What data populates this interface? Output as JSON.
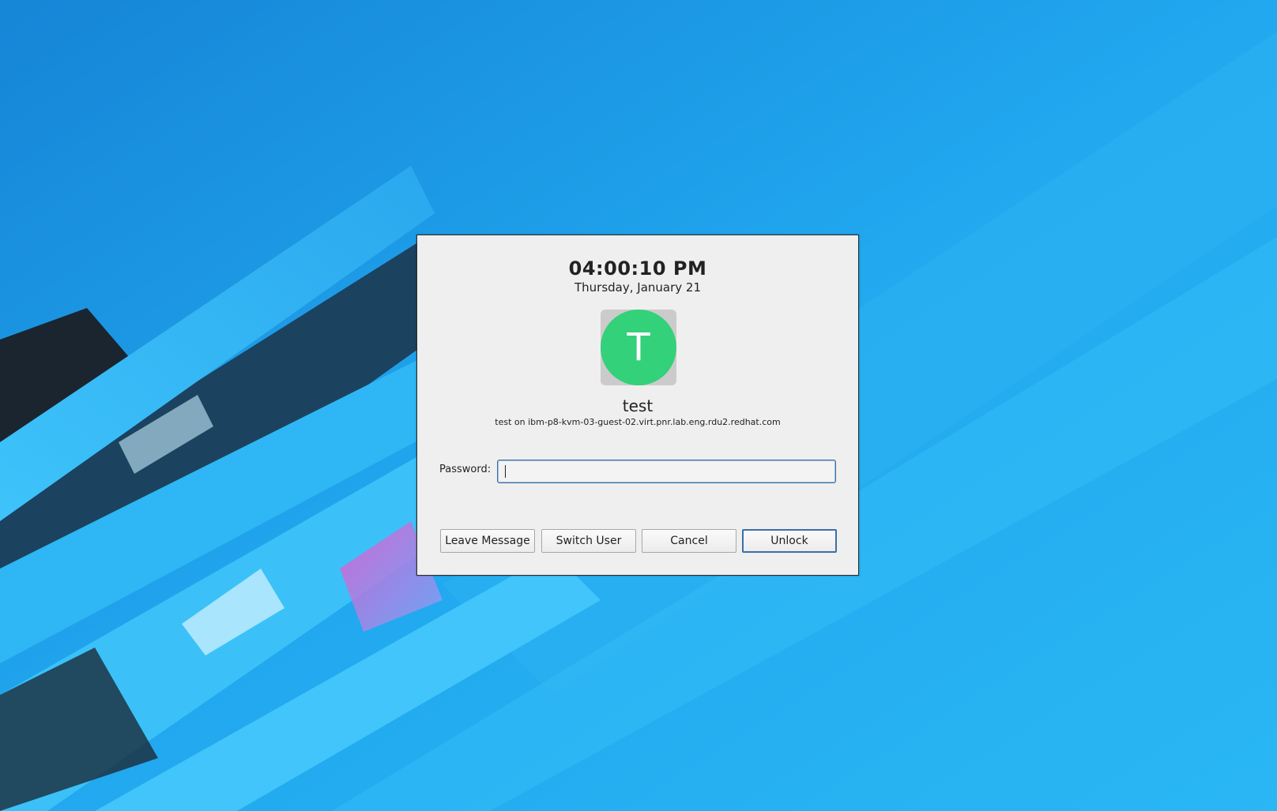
{
  "colors": {
    "wallpaper_base": "#1fa3ec",
    "wallpaper_light": "#2fbaf6",
    "wallpaper_dark": "#1a2530",
    "accent_pink": "#f06bd8",
    "dialog_bg": "#efefef",
    "avatar_green": "#33d17a",
    "focus_border": "#3d6fa8"
  },
  "lock_dialog": {
    "clock": "04:00:10 PM",
    "date": "Thursday, January 21",
    "avatar_letter": "T",
    "username": "test",
    "host_line": "test on ibm-p8-kvm-03-guest-02.virt.pnr.lab.eng.rdu2.redhat.com",
    "password_label": "Password:",
    "password_value": "",
    "buttons": {
      "leave_message": "Leave Message",
      "switch_user": "Switch User",
      "cancel": "Cancel",
      "unlock": "Unlock"
    }
  }
}
